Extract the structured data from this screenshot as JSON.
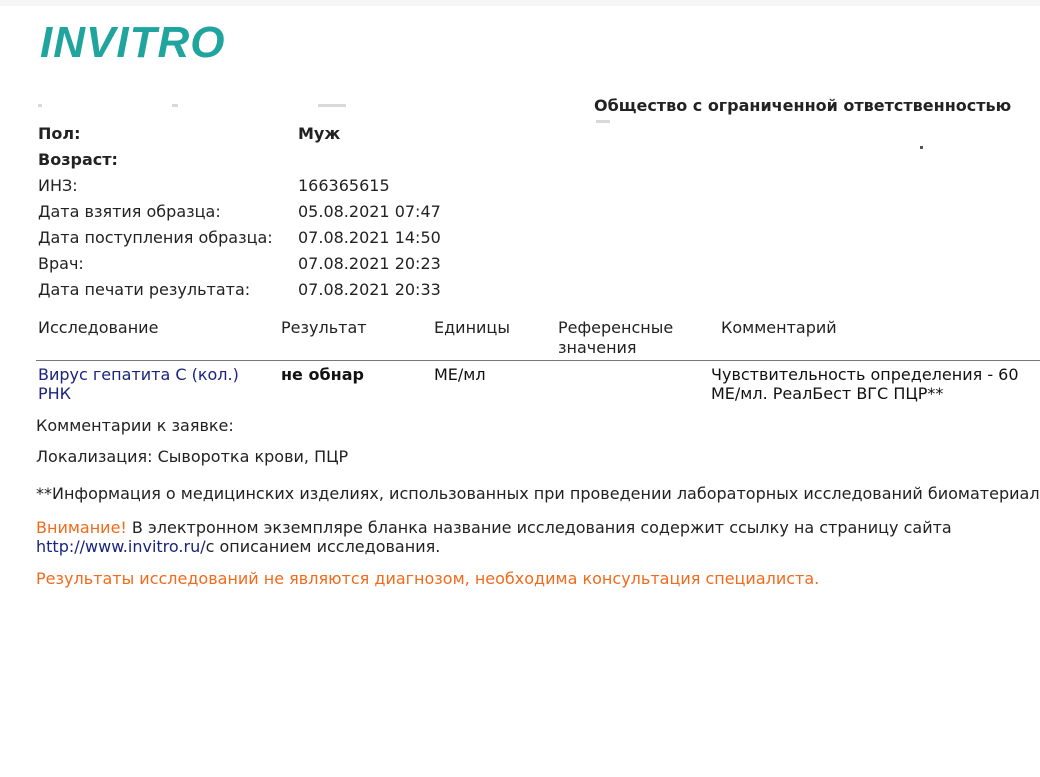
{
  "header": {
    "logo": "INVITRO",
    "organization": "Общество с ограниченной ответственностью"
  },
  "patient": {
    "sex_label": "Пол:",
    "sex_value": "Муж",
    "age_label": "Возраст:",
    "inz_label": "ИНЗ:",
    "inz_value": "166365615",
    "sample_taken_label": "Дата взятия образца:",
    "sample_taken_value": "05.08.2021 07:47",
    "sample_received_label": "Дата поступления образца:",
    "sample_received_value": "07.08.2021 14:50",
    "doctor_label": "Врач:",
    "doctor_value": "07.08.2021 20:23",
    "print_date_label": "Дата печати результата:",
    "print_date_value": "07.08.2021 20:33"
  },
  "table": {
    "columns": {
      "test": "Исследование",
      "result": "Результат",
      "units": "Единицы",
      "ref_line1": "Референсные",
      "ref_line2": "значения",
      "comment": "Комментарий"
    },
    "rows": [
      {
        "test_line1": "Вирус гепатита С (кол.)",
        "test_line2": "РНК",
        "result": "не обнар",
        "units": "МЕ/мл",
        "reference": "",
        "comment_line1": "Чувствительность определения - 60",
        "comment_line2": "МЕ/мл. РеалБест ВГС ПЦР**"
      }
    ]
  },
  "notes": {
    "comments_label": "Комментарии к заявке:",
    "localization": "Локализация: Сыворотка крови, ПЦР",
    "devices_info": "**Информация о медицинских изделиях, использованных при проведении лабораторных исследований биоматериала",
    "attention_word": "Внимание!",
    "attention_text": "В электронном экземпляре бланка название исследования содержит ссылку на страницу сайта",
    "site_link": "http://www.invitro.ru/",
    "site_link_suffix": "с описанием исследования.",
    "disclaimer": "Результаты исследований не являются диагнозом, необходима консультация специалиста."
  },
  "colors": {
    "brand": "#1fa59d",
    "link": "#1a237e",
    "warning": "#f26a1b"
  }
}
